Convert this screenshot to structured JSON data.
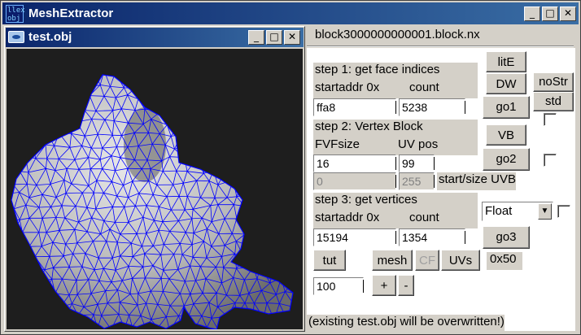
{
  "app": {
    "icon_text": "llex obj",
    "title": "MeshExtractor",
    "caption_buttons": [
      "_",
      "□",
      "✕"
    ]
  },
  "viewer": {
    "title": "test.obj",
    "caption_buttons": [
      "_",
      "□",
      "✕"
    ]
  },
  "file_label": "block3000000000001.block.nx",
  "step1": {
    "heading": "step 1: get face indices",
    "addr_label": "startaddr 0x",
    "count_label": "count",
    "addr_value": "ffa8",
    "count_value": "5238",
    "lite_label": "litE",
    "dw_label": "DW",
    "go1_label": "go1",
    "nostr_label": "noStr",
    "std_label": "std"
  },
  "step2": {
    "heading": "step 2: Vertex Block",
    "fvf_label": "FVFsize",
    "uvpos_label": "UV pos",
    "fvf_value": "16",
    "uvpos_value": "99",
    "start_value": "0",
    "size_value": "255",
    "startsize_label": "start/size UVB",
    "vb_label": "VB",
    "go2_label": "go2"
  },
  "step3": {
    "heading": "step 3: get vertices",
    "addr_label": "startaddr 0x",
    "count_label": "count",
    "addr_value": "15194",
    "count_value": "1354",
    "format_selected": "Float",
    "go3_label": "go3"
  },
  "bottom": {
    "tut_label": "tut",
    "mesh_label": "mesh",
    "cf_label": "CF",
    "uvs_label": "UVs",
    "hex_label": "0x50",
    "scale_value": "100",
    "plus_label": "+",
    "minus_label": "-",
    "note": "(existing test.obj will be overwritten!)"
  },
  "colors": {
    "titlebar_start": "#0a246a",
    "titlebar_end": "#3a6ea5",
    "wire": "#0000ff",
    "mesh_fill": "#c8c8c8",
    "viewport_bg": "#1e1e1e"
  }
}
